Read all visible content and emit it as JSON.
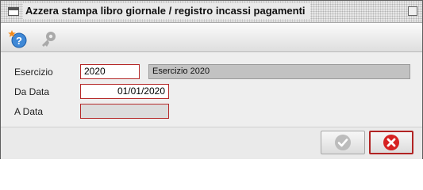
{
  "window": {
    "title": "Azzera stampa libro giornale / registro incassi pagamenti"
  },
  "toolbar": {
    "icons": [
      "help-icon",
      "key-icon"
    ]
  },
  "form": {
    "esercizio_label": "Esercizio",
    "esercizio_value": "2020",
    "esercizio_desc": "Esercizio 2020",
    "da_data_label": "Da Data",
    "da_data_value": "01/01/2020",
    "a_data_label": "A Data",
    "a_data_value": ""
  },
  "footer": {
    "buttons": [
      "confirm-button",
      "cancel-button"
    ]
  },
  "colors": {
    "field_border": "#b52a2a",
    "cancel_icon": "#d62222",
    "confirm_icon_disabled": "#b5b5b5"
  }
}
